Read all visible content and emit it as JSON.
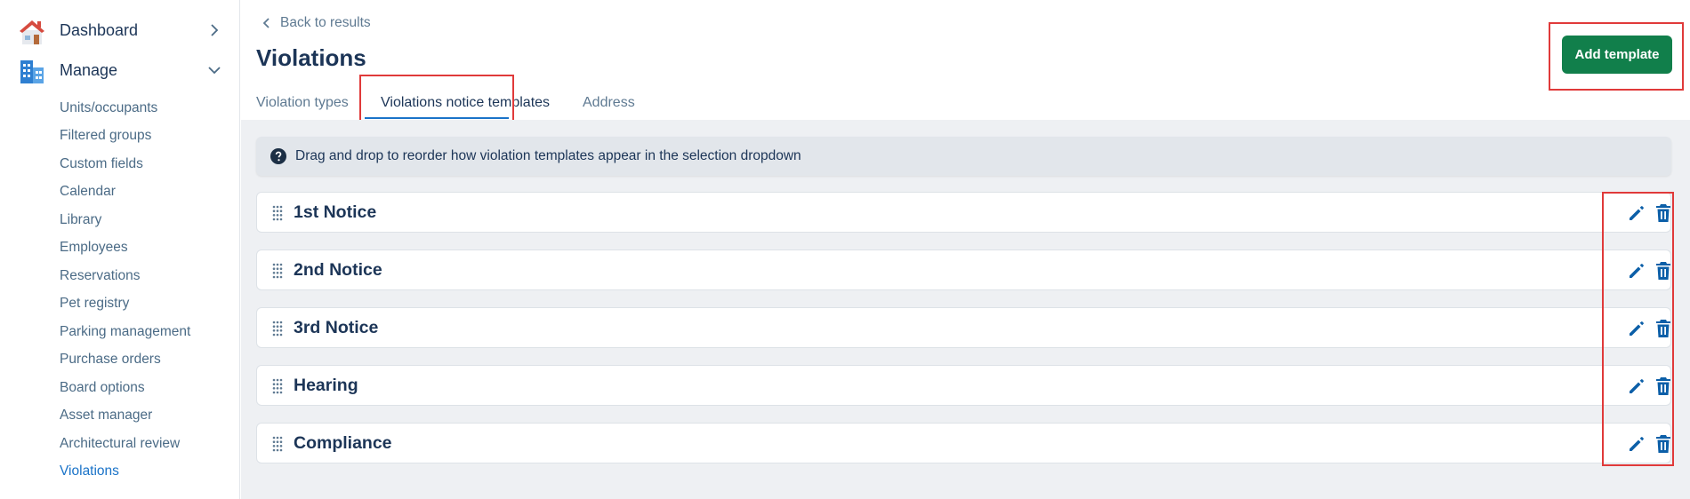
{
  "sidebar": {
    "dashboard_label": "Dashboard",
    "manage_label": "Manage",
    "items": [
      {
        "label": "Units/occupants"
      },
      {
        "label": "Filtered groups"
      },
      {
        "label": "Custom fields"
      },
      {
        "label": "Calendar"
      },
      {
        "label": "Library"
      },
      {
        "label": "Employees"
      },
      {
        "label": "Reservations"
      },
      {
        "label": "Pet registry"
      },
      {
        "label": "Parking management"
      },
      {
        "label": "Purchase orders"
      },
      {
        "label": "Board options"
      },
      {
        "label": "Asset manager"
      },
      {
        "label": "Architectural review"
      },
      {
        "label": "Violations",
        "active": true
      }
    ]
  },
  "header": {
    "back_label": "Back to results",
    "title": "Violations",
    "add_button_label": "Add template"
  },
  "tabs": [
    {
      "label": "Violation types"
    },
    {
      "label": "Violations notice templates",
      "active": true
    },
    {
      "label": "Address"
    }
  ],
  "info_text": "Drag and drop to reorder how violation templates appear in the selection dropdown",
  "templates": [
    {
      "name": "1st Notice"
    },
    {
      "name": "2nd Notice"
    },
    {
      "name": "3rd Notice"
    },
    {
      "name": "Hearing"
    },
    {
      "name": "Compliance"
    }
  ],
  "colors": {
    "primary_text": "#1c3557",
    "link_blue": "#1a73c8",
    "action_blue": "#0c5fa8",
    "button_green": "#117f4b",
    "highlight_red": "#e03a3a"
  },
  "icons": {
    "dashboard": "house-icon",
    "manage": "building-icon",
    "back": "chevron-left-icon",
    "info": "question-circle-icon",
    "drag": "drag-handle-icon",
    "edit": "pencil-icon",
    "delete": "trash-icon"
  }
}
